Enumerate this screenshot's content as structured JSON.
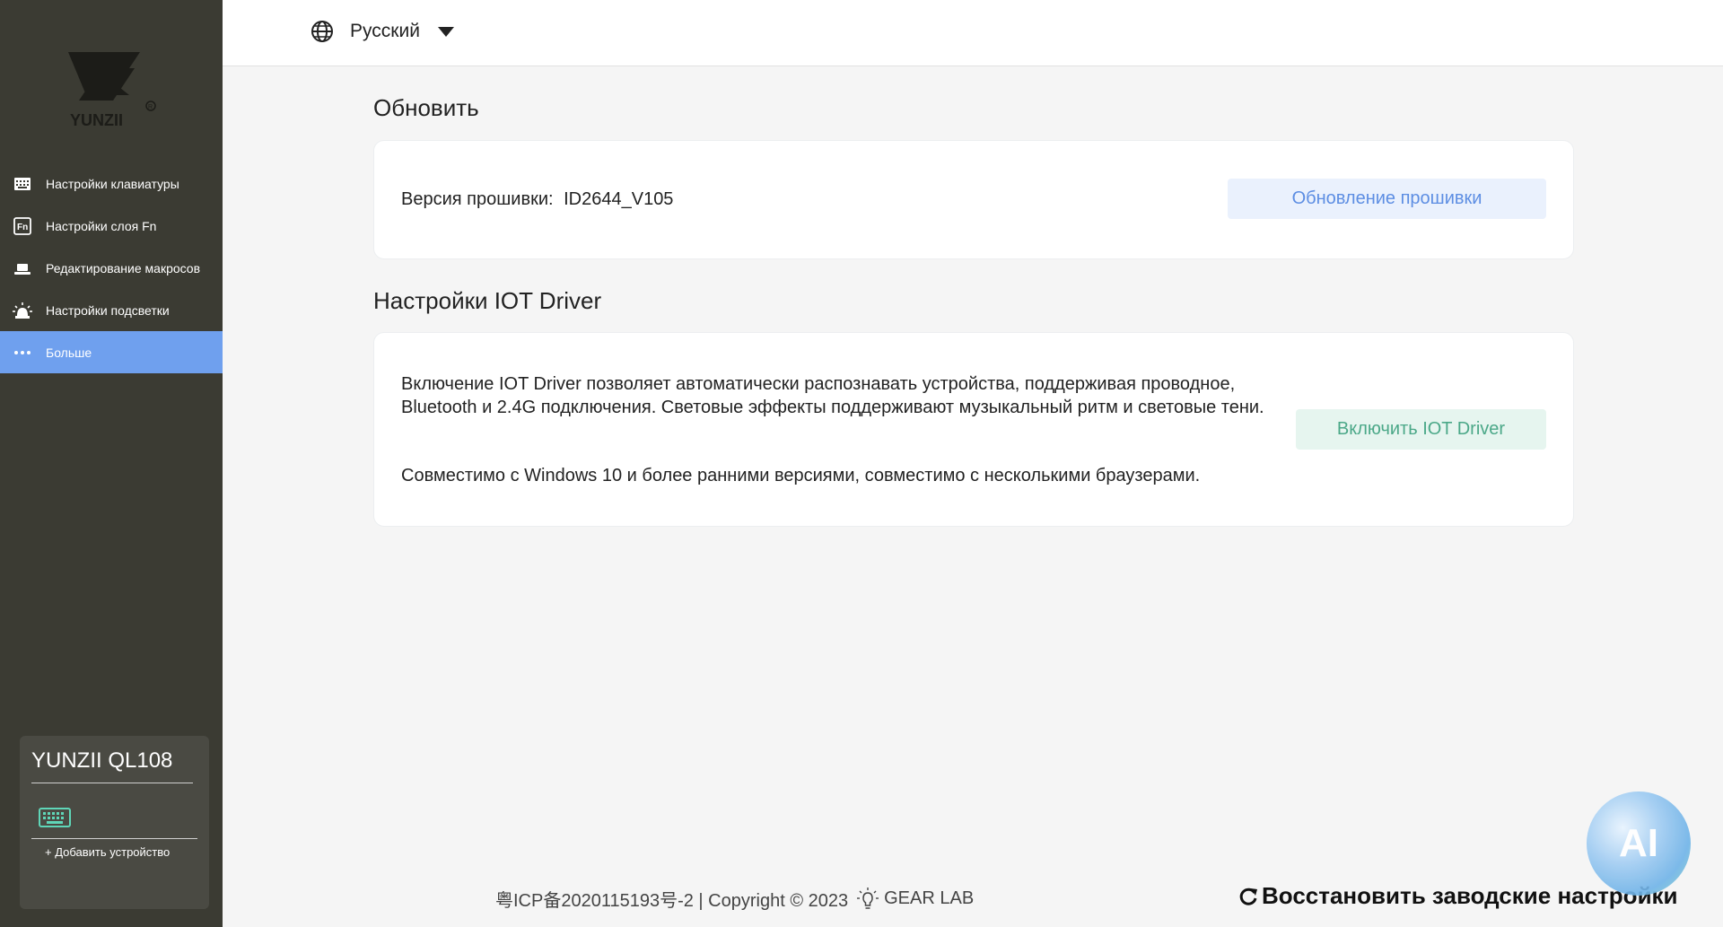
{
  "brand": {
    "logo_text": "YUNZII"
  },
  "sidebar": {
    "items": [
      {
        "label": "Настройки клавиатуры",
        "icon": "keyboard-icon"
      },
      {
        "label": "Настройки слоя Fn",
        "icon": "fn-icon"
      },
      {
        "label": "Редактирование макросов",
        "icon": "macro-icon"
      },
      {
        "label": "Настройки подсветки",
        "icon": "light-icon"
      },
      {
        "label": "Больше",
        "icon": "more-icon",
        "active": true
      }
    ],
    "device": {
      "name": "YUNZII QL108",
      "add_label": "+ Добавить устройство"
    }
  },
  "topbar": {
    "language": "Русский"
  },
  "update": {
    "title": "Обновить",
    "firmware_label": "Версия прошивки:",
    "firmware_value": "ID2644_V105",
    "button": "Обновление прошивки"
  },
  "iot": {
    "title": "Настройки IOT Driver",
    "description": "Включение IOT Driver позволяет автоматически распознавать устройства, поддерживая проводное, Bluetooth и 2.4G подключения. Световые эффекты поддерживают музыкальный ритм и световые тени.",
    "compat": "Совместимо с Windows 10 и более ранними версиями, совместимо с несколькими браузерами.",
    "button": "Включить IOT Driver"
  },
  "footer": {
    "icp": "粤ICP备2020115193号-2 | Copyright © 2023",
    "brand": "GEAR LAB",
    "reset": "Восстановить заводские настройки"
  },
  "ai_bubble": {
    "label": "AI"
  },
  "colors": {
    "sidebar": "#3b3b33",
    "active": "#6fa0ee",
    "update_btn": "#5d8ee3",
    "iot_btn": "#4ba888"
  }
}
